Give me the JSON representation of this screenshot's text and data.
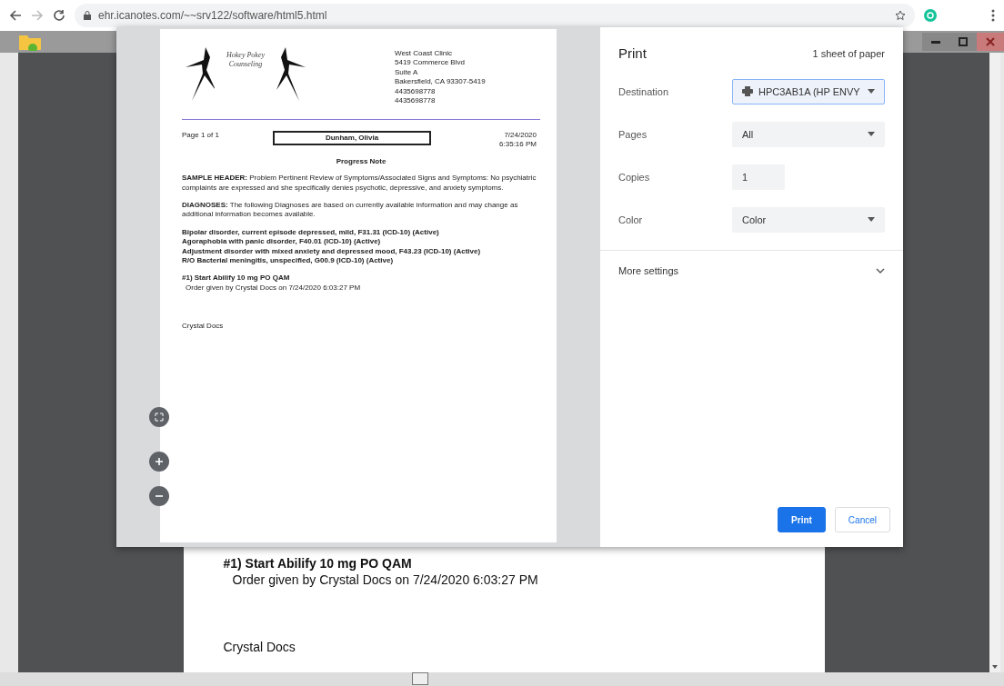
{
  "browser": {
    "url": "ehr.icanotes.com/~~srv122/software/html5.html"
  },
  "background_document": {
    "order_title": "#1) Start Abilify 10 mg PO QAM",
    "order_detail": "Order given by Crystal Docs on 7/24/2020 6:03:27 PM",
    "signature": "Crystal Docs"
  },
  "preview": {
    "logo_text": "Hokey Pokey Counseling",
    "address": [
      "West Coast Clinic",
      "5419 Commerce Blvd",
      "Suite A",
      "Bakersfield, CA 93307-5419",
      "4435698778",
      "4435698778"
    ],
    "page_label": "Page 1 of 1",
    "patient": "Dunham, Olivia",
    "date": "7/24/2020",
    "time": "6:35:16 PM",
    "title": "Progress Note",
    "paragraphs": [
      "**SAMPLE HEADER:** Problem Pertinent Review of Symptoms/Associated Signs and Symptoms: No psychiatric complaints are expressed and she specifically denies psychotic, depressive, and anxiety symptoms.",
      "**DIAGNOSES:** The following Diagnoses are based on currently available information and may change as additional information becomes available."
    ],
    "diagnoses": [
      "Bipolar disorder, current episode depressed, mild, F31.31 (ICD-10) (Active)",
      "Agoraphobia with panic disorder, F40.01 (ICD-10) (Active)",
      "Adjustment disorder with mixed anxiety and depressed mood, F43.23 (ICD-10) (Active)",
      "R/O Bacterial meningitis, unspecified, G00.9 (ICD-10) (Active)"
    ],
    "order_title": "#1) Start Abilify 10 mg PO QAM",
    "order_detail": "Order given by Crystal Docs on 7/24/2020 6:03:27 PM",
    "signature": "Crystal Docs"
  },
  "print": {
    "title": "Print",
    "sheets": "1 sheet of paper",
    "settings": [
      {
        "label": "Destination",
        "kind": "printer",
        "value": "HPC3AB1A (HP ENVY",
        "focused": true
      },
      {
        "label": "Pages",
        "kind": "select",
        "value": "All",
        "focused": false
      },
      {
        "label": "Copies",
        "kind": "number",
        "value": "1",
        "focused": false
      },
      {
        "label": "Color",
        "kind": "select",
        "value": "Color",
        "focused": false
      }
    ],
    "more_settings": "More settings",
    "buttons": [
      {
        "label": "Print",
        "kind": "primary"
      },
      {
        "label": "Cancel",
        "kind": "secondary"
      }
    ]
  }
}
